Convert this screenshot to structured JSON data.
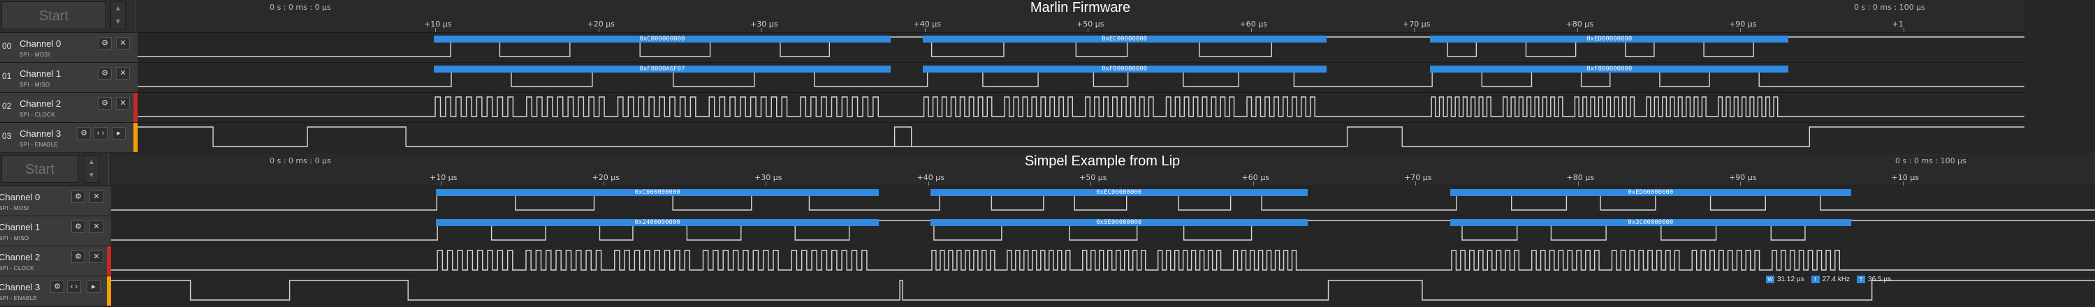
{
  "panels": [
    {
      "title": "Marlin Firmware",
      "start_label": "Start",
      "abs_time_left": "0 s : 0 ms : 0 µs",
      "abs_time_right": "0 s : 0 ms : 100 µs",
      "ticks": [
        "+10 µs",
        "+20 µs",
        "+30 µs",
        "+40 µs",
        "+50 µs",
        "+60 µs",
        "+70 µs",
        "+80 µs",
        "+90 µs",
        "+1"
      ],
      "channels": [
        {
          "num": "00",
          "name": "Channel 0",
          "sub": "SPI - MOSI",
          "color": "#3a3a3a",
          "decodes": [
            "0xC000000000",
            "0xEC00000000",
            "0xED00000000"
          ]
        },
        {
          "num": "01",
          "name": "Channel 1",
          "sub": "SPI - MISO",
          "color": "#3a3a3a",
          "decodes": [
            "0xF8000A6F07",
            "0xF800000000",
            "0xF800000000"
          ]
        },
        {
          "num": "02",
          "name": "Channel 2",
          "sub": "SPI - CLOCK",
          "color": "#c62828",
          "decodes": []
        },
        {
          "num": "03",
          "name": "Channel 3",
          "sub": "SPI - ENABLE",
          "color": "#f2a000",
          "decodes": []
        }
      ]
    },
    {
      "title": "Simpel Example from Lip",
      "start_label": "Start",
      "abs_time_left": "0 s : 0 ms : 0 µs",
      "abs_time_right": "0 s : 0 ms : 100 µs",
      "ticks": [
        "+10 µs",
        "+20 µs",
        "+30 µs",
        "+40 µs",
        "+50 µs",
        "+60 µs",
        "+70 µs",
        "+80 µs",
        "+90 µs",
        "+10 µs"
      ],
      "channels": [
        {
          "num": "",
          "name": "Channel 0",
          "sub": "SPI - MOSI",
          "color": "#3a3a3a",
          "decodes": [
            "0xC000000000",
            "0xEC00000000",
            "0xED00000000"
          ]
        },
        {
          "num": "",
          "name": "Channel 1",
          "sub": "SPI - MISO",
          "color": "#3a3a3a",
          "decodes": [
            "0x2400000000",
            "0x9E00000000",
            "0x3C00000000"
          ]
        },
        {
          "num": "",
          "name": "Channel 2",
          "sub": "SPI - CLOCK",
          "color": "#c62828",
          "decodes": []
        },
        {
          "num": "",
          "name": "Channel 3",
          "sub": "SPI - ENABLE",
          "color": "#f2a000",
          "decodes": []
        }
      ],
      "measurement": {
        "width": "31.12 µs",
        "frequency": "27.4 kHz",
        "period": "36.5 µs",
        "badges": [
          "W",
          "f",
          "T"
        ]
      }
    }
  ],
  "icons": {
    "gear": "gear-icon",
    "close": "close-icon",
    "caret": "caret-down-icon",
    "scroll": "scroll-arrows-icon"
  }
}
